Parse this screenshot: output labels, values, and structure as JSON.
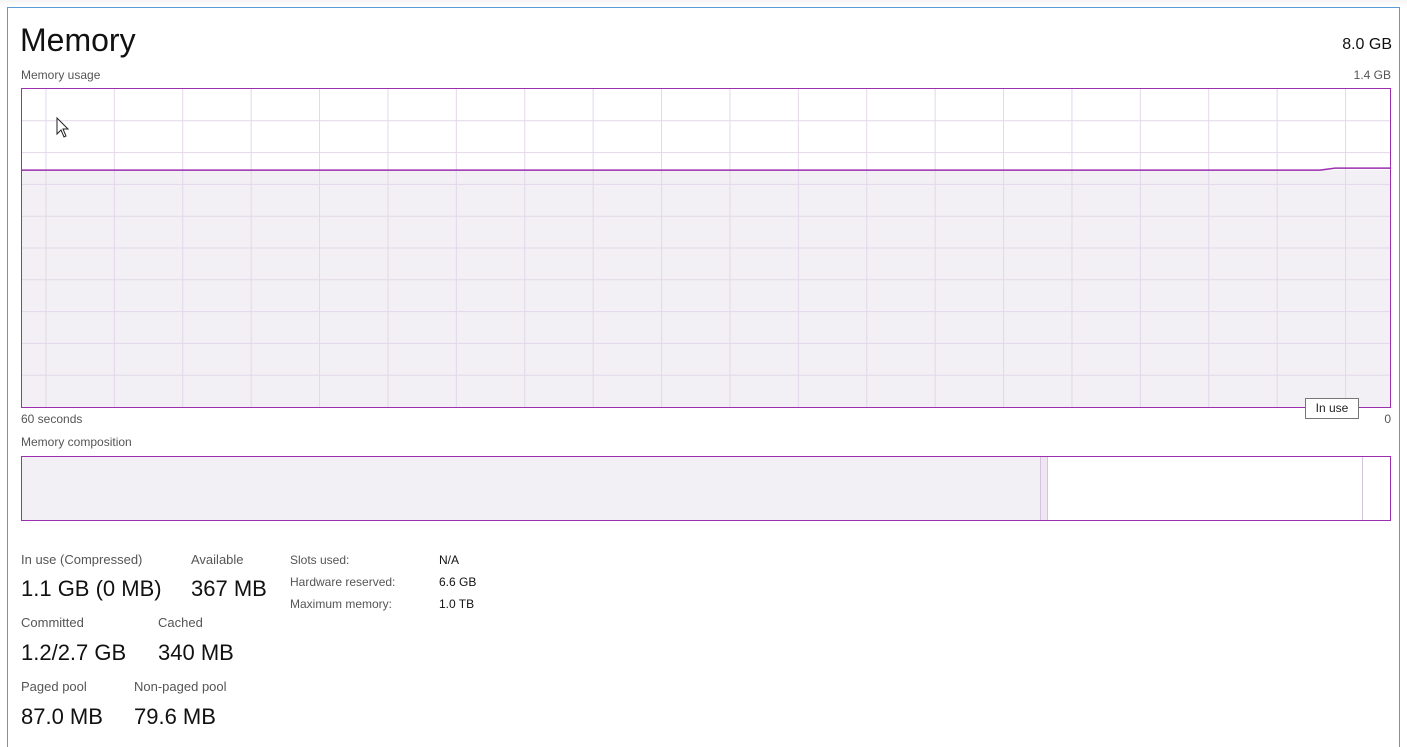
{
  "header": {
    "title": "Memory",
    "capacity": "8.0 GB"
  },
  "usage_graph": {
    "label": "Memory usage",
    "max_label": "1.4 GB",
    "time_label": "60 seconds",
    "min_label": "0",
    "tooltip": "In use",
    "line_color": "#9b2fae",
    "fill_color": "#f2f0f5",
    "grid_color": "#e3d7ea",
    "in_use_fraction": 0.745
  },
  "composition": {
    "label": "Memory composition",
    "in_use_fraction": 0.745,
    "modified_fraction": 0.005,
    "standby_fraction": 0.23,
    "free_fraction": 0.02
  },
  "stats": {
    "in_use_label": "In use (Compressed)",
    "in_use_value": "1.1 GB (0 MB)",
    "available_label": "Available",
    "available_value": "367 MB",
    "committed_label": "Committed",
    "committed_value": "1.2/2.7 GB",
    "cached_label": "Cached",
    "cached_value": "340 MB",
    "paged_label": "Paged pool",
    "paged_value": "87.0 MB",
    "nonpaged_label": "Non-paged pool",
    "nonpaged_value": "79.6 MB"
  },
  "info": {
    "slots_label": "Slots used:",
    "slots_value": "N/A",
    "hw_reserved_label": "Hardware reserved:",
    "hw_reserved_value": "6.6 GB",
    "max_memory_label": "Maximum memory:",
    "max_memory_value": "1.0 TB"
  },
  "icons": {
    "cursor": "mouse-pointer-icon"
  }
}
